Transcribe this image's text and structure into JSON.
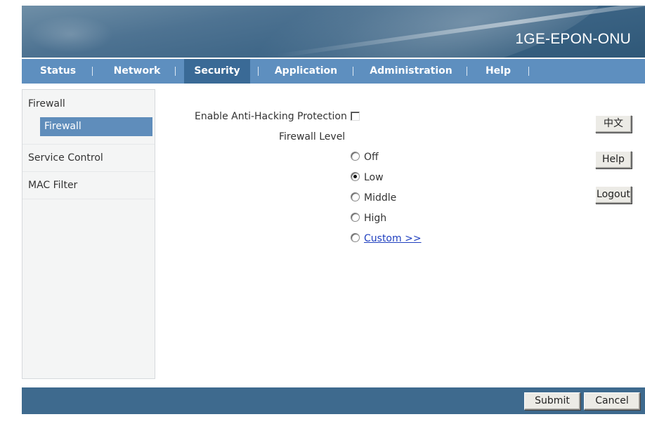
{
  "header": {
    "product_name": "1GE-EPON-ONU"
  },
  "nav": {
    "items": [
      {
        "label": "Status"
      },
      {
        "label": "Network"
      },
      {
        "label": "Security",
        "active": true
      },
      {
        "label": "Application"
      },
      {
        "label": "Administration"
      },
      {
        "label": "Help"
      }
    ]
  },
  "sidebar": {
    "groups": [
      {
        "label": "Firewall",
        "subitems": [
          {
            "label": "Firewall",
            "selected": true
          }
        ]
      },
      {
        "label": "Service Control"
      },
      {
        "label": "MAC Filter"
      }
    ]
  },
  "form": {
    "anti_hacking_label": "Enable Anti-Hacking Protection",
    "anti_hacking_checked": false,
    "firewall_level_label": "Firewall Level",
    "levels": [
      {
        "label": "Off",
        "checked": false
      },
      {
        "label": "Low",
        "checked": true
      },
      {
        "label": "Middle",
        "checked": false
      },
      {
        "label": "High",
        "checked": false
      },
      {
        "label": "Custom >>",
        "checked": false,
        "is_link": true
      }
    ]
  },
  "side_buttons": {
    "language": "中文",
    "help": "Help",
    "logout": "Logout"
  },
  "footer": {
    "submit": "Submit",
    "cancel": "Cancel"
  },
  "colors": {
    "nav_bg": "#5e8fbf",
    "nav_active_bg": "#3a6a96",
    "footer_bg": "#3e6a8e",
    "sidebar_selected_bg": "#5f8dbb",
    "link": "#1f3fbf"
  }
}
